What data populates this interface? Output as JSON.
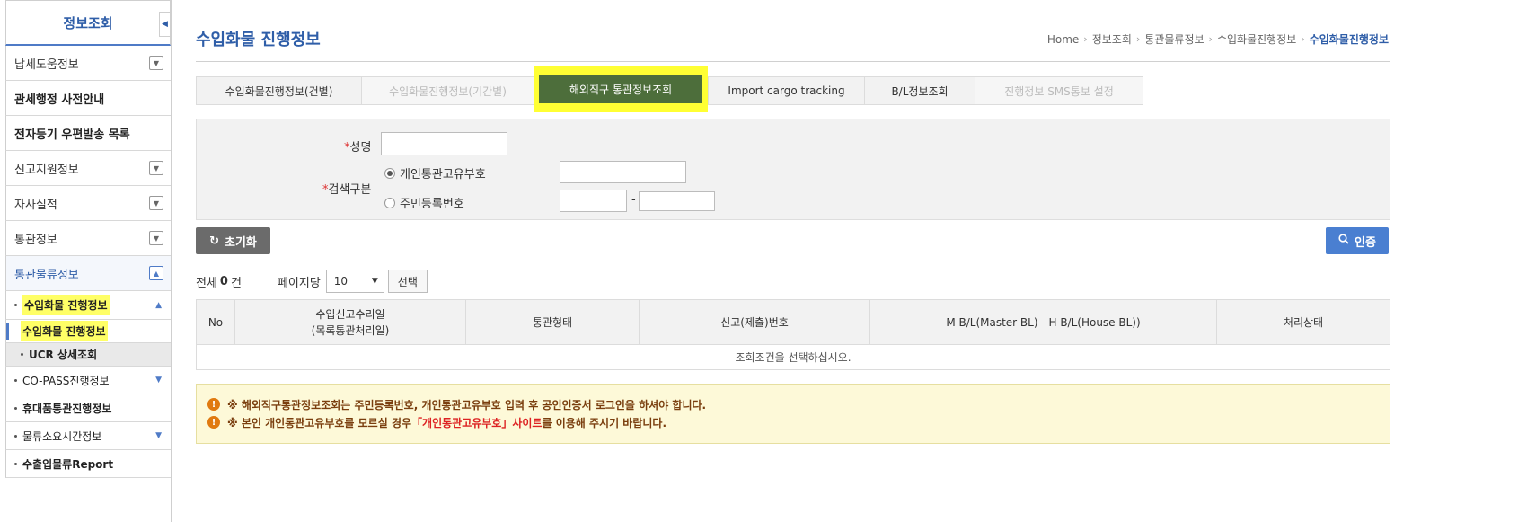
{
  "sidebar": {
    "title": "정보조회",
    "collapse_icon": "◀",
    "items": [
      {
        "label": "납세도움정보",
        "toggle": "down"
      },
      {
        "label": "관세행정 사전안내",
        "toggle": ""
      },
      {
        "label": "전자등기 우편발송 목록",
        "toggle": ""
      },
      {
        "label": "신고지원정보",
        "toggle": "down"
      },
      {
        "label": "자사실적",
        "toggle": "down"
      },
      {
        "label": "통관정보",
        "toggle": "down"
      },
      {
        "label": "통관물류정보",
        "toggle": "up"
      }
    ],
    "sub": {
      "group_label": "수입화물 진행정보",
      "active_label": "수입화물 진행정보",
      "ucr_label": "UCR 상세조회",
      "items": [
        {
          "label": "CO-PASS진행정보"
        },
        {
          "label": "휴대품통관진행정보"
        },
        {
          "label": "물류소요시간정보"
        },
        {
          "label": "수출입물류Report"
        }
      ]
    }
  },
  "page": {
    "title": "수입화물 진행정보"
  },
  "breadcrumb": [
    "Home",
    "정보조회",
    "통관물류정보",
    "수입화물진행정보",
    "수입화물진행정보"
  ],
  "tabs": [
    {
      "label": "수입화물진행정보(건별)",
      "state": "normal"
    },
    {
      "label": "수입화물진행정보(기간별)",
      "state": "disabled"
    },
    {
      "label": "해외직구 통관정보조회",
      "state": "active"
    },
    {
      "label": "Import cargo tracking",
      "state": "normal"
    },
    {
      "label": "B/L정보조회",
      "state": "normal"
    },
    {
      "label": "진행정보 SMS통보 설정",
      "state": "disabled"
    }
  ],
  "form": {
    "required_mark": "*",
    "name_label": "성명",
    "name_value": "",
    "search_type_label": "검색구분",
    "option_customs_id": "개인통관고유부호",
    "option_resident_no": "주민등록번호",
    "dash": "-"
  },
  "buttons": {
    "reset": "초기화",
    "auth": "인증"
  },
  "list": {
    "total_prefix": "전체",
    "total_count": "0",
    "total_suffix": "건",
    "per_page_label": "페이지당",
    "per_page_value": "10",
    "select_button": "선택"
  },
  "table": {
    "headers": [
      "No",
      "수입신고수리일",
      "(목록통관처리일)",
      "통관형태",
      "신고(제출)번호",
      "M B/L(Master BL) - H B/L(House BL))",
      "처리상태"
    ],
    "empty_message": "조회조건을 선택하십시오."
  },
  "notice": {
    "line1": "※ 해외직구통관정보조회는 주민등록번호, 개인통관고유부호 입력 후 공인인증서 로그인을 하셔야 합니다.",
    "line2_prefix": "※ 본인 개인통관고유부호를 모르실 경우 ",
    "line2_link": "「개인통관고유부호」사이트",
    "line2_suffix": "를 이용해 주시기 바랍니다."
  },
  "colors": {
    "accent": "#2f5ea8",
    "active_tab": "#4d6e3b",
    "highlight": "#ffff33",
    "notice_bg": "#fdf9d8"
  }
}
